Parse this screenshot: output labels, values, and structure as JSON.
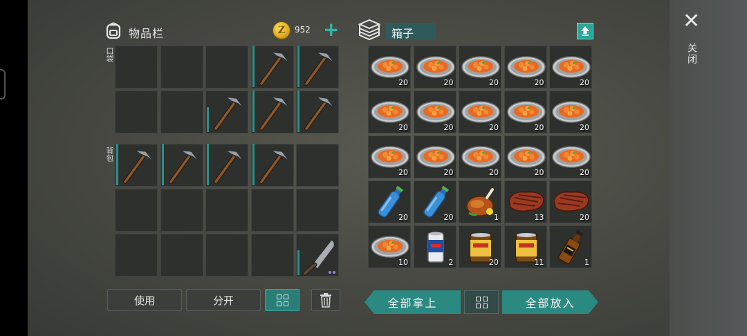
{
  "inventory": {
    "title": "物品栏",
    "coins": "952",
    "pocket_label": "口袋",
    "backpack_label": "背包",
    "pocket": [
      {
        "item": null
      },
      {
        "item": null
      },
      {
        "item": null
      },
      {
        "item": "pickaxe-icon",
        "durability": 1.0
      },
      {
        "item": "pickaxe-icon",
        "durability": 1.0
      },
      {
        "item": null
      },
      {
        "item": null
      },
      {
        "item": "pickaxe-icon",
        "durability": 0.6
      },
      {
        "item": "pickaxe-icon",
        "durability": 1.0
      },
      {
        "item": "pickaxe-icon",
        "durability": 1.0
      }
    ],
    "backpack": [
      {
        "item": "pickaxe-icon",
        "durability": 1.0
      },
      {
        "item": "pickaxe-icon",
        "durability": 1.0
      },
      {
        "item": "pickaxe-icon",
        "durability": 1.0
      },
      {
        "item": "pickaxe-icon",
        "durability": 1.0
      },
      {
        "item": null
      },
      {
        "item": null
      },
      {
        "item": null
      },
      {
        "item": null
      },
      {
        "item": null
      },
      {
        "item": null
      },
      {
        "item": null
      },
      {
        "item": null
      },
      {
        "item": null
      },
      {
        "item": null
      },
      {
        "item": "machete-icon",
        "durability": 0.6,
        "dots": 2
      }
    ],
    "buttons": {
      "use": "使用",
      "split": "分开"
    }
  },
  "box": {
    "title": "箱子",
    "close_label": "关闭",
    "take_all": "全部拿上",
    "put_all": "全部放入",
    "slots": [
      {
        "item": "stew-bowl-icon",
        "count": "20"
      },
      {
        "item": "stew-bowl-icon",
        "count": "20"
      },
      {
        "item": "stew-bowl-icon",
        "count": "20"
      },
      {
        "item": "stew-bowl-icon",
        "count": "20"
      },
      {
        "item": "stew-bowl-icon",
        "count": "20"
      },
      {
        "item": "stew-bowl-icon",
        "count": "20"
      },
      {
        "item": "stew-bowl-icon",
        "count": "20"
      },
      {
        "item": "stew-bowl-icon",
        "count": "20"
      },
      {
        "item": "stew-bowl-icon",
        "count": "20"
      },
      {
        "item": "stew-bowl-icon",
        "count": "20"
      },
      {
        "item": "stew-bowl-icon",
        "count": "20"
      },
      {
        "item": "stew-bowl-icon",
        "count": "20"
      },
      {
        "item": "stew-bowl-icon",
        "count": "20"
      },
      {
        "item": "stew-bowl-icon",
        "count": "20"
      },
      {
        "item": "stew-bowl-icon",
        "count": "20"
      },
      {
        "item": "water-bottle-icon",
        "count": "20"
      },
      {
        "item": "water-bottle-icon",
        "count": "20"
      },
      {
        "item": "roast-chicken-icon",
        "count": "1"
      },
      {
        "item": "steak-icon",
        "count": "13"
      },
      {
        "item": "steak-icon",
        "count": "20"
      },
      {
        "item": "stew-bowl-icon",
        "count": "10"
      },
      {
        "item": "soda-can-icon",
        "count": "2"
      },
      {
        "item": "canned-food-icon",
        "count": "20"
      },
      {
        "item": "canned-food-icon",
        "count": "11"
      },
      {
        "item": "whiskey-bottle-icon",
        "count": "1"
      }
    ]
  },
  "colors": {
    "accent": "#2a8a82",
    "slot_bg": "#2e302e",
    "durability": "#2d8f8c",
    "coin": "#e0ac1c"
  }
}
